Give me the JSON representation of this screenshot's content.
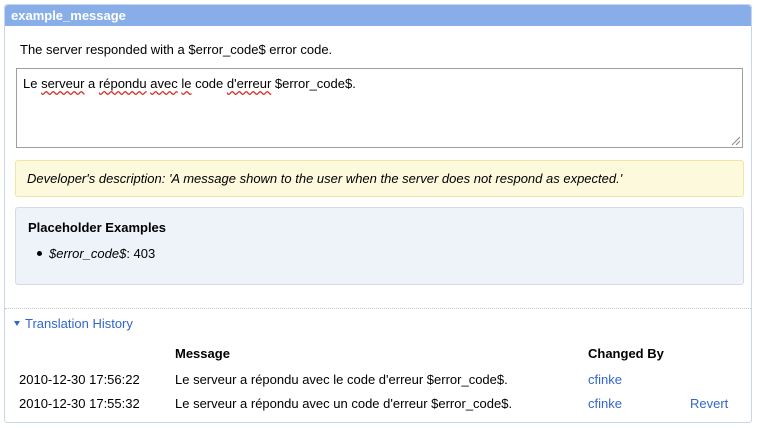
{
  "panel": {
    "title": "example_message",
    "source_text": "The server responded with a $error_code$ error code.",
    "translation": {
      "segments": [
        {
          "text": "Le ",
          "misspelled": false
        },
        {
          "text": "serveur",
          "misspelled": true
        },
        {
          "text": " a ",
          "misspelled": false
        },
        {
          "text": "répondu",
          "misspelled": true
        },
        {
          "text": " ",
          "misspelled": false
        },
        {
          "text": "avec",
          "misspelled": true
        },
        {
          "text": " ",
          "misspelled": false
        },
        {
          "text": "le",
          "misspelled": true
        },
        {
          "text": " code ",
          "misspelled": false
        },
        {
          "text": "d'erreur",
          "misspelled": true
        },
        {
          "text": " $error_code$.",
          "misspelled": false
        }
      ]
    },
    "description": "Developer's description: 'A message shown to the user when the server does not respond as expected.'",
    "placeholder_examples": {
      "heading": "Placeholder Examples",
      "items": [
        {
          "name": "$error_code$",
          "value": ": 403"
        }
      ]
    }
  },
  "history": {
    "toggle_label": "Translation History",
    "headers": {
      "message": "Message",
      "changed_by": "Changed By"
    },
    "rows": [
      {
        "timestamp": "2010-12-30 17:56:22",
        "message": "Le serveur a répondu avec le code d'erreur $error_code$.",
        "user": "cfinke",
        "action": ""
      },
      {
        "timestamp": "2010-12-30 17:55:32",
        "message": "Le serveur a répondu avec un code d'erreur $error_code$.",
        "user": "cfinke",
        "action": "Revert"
      }
    ]
  },
  "colors": {
    "title_bar": "#87aee8",
    "link": "#3366cc",
    "description_bg": "#fdf9dc",
    "examples_bg": "#eef2f9"
  }
}
